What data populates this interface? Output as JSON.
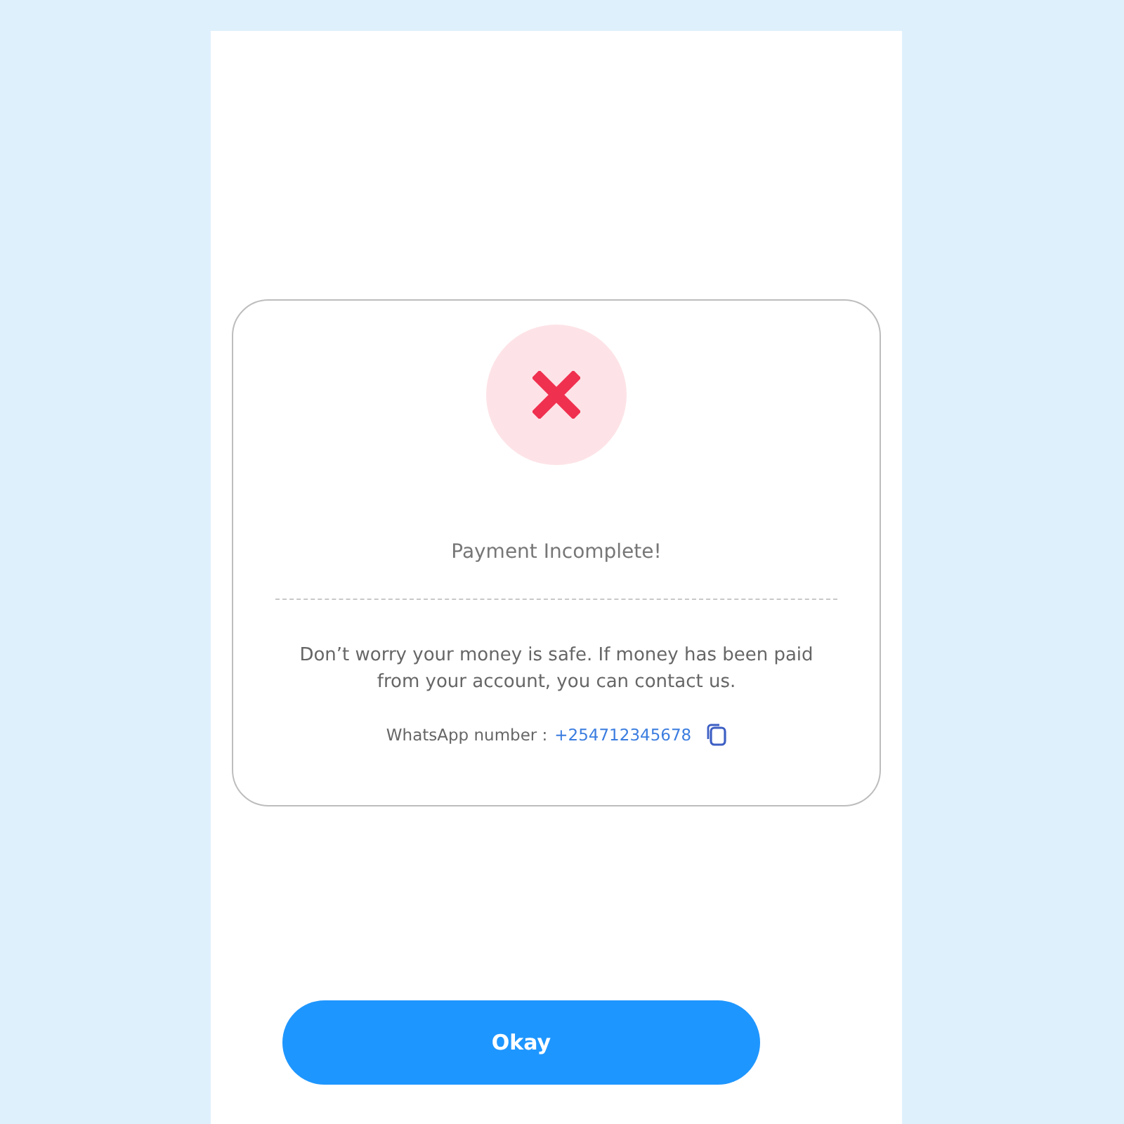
{
  "status": {
    "title": "Payment Incomplete!",
    "message": "Don’t worry your money is safe. If money has been paid from your account, you can contact us.",
    "contact_label": "WhatsApp number :",
    "contact_number": "+254712345678"
  },
  "button": {
    "label": "Okay"
  }
}
